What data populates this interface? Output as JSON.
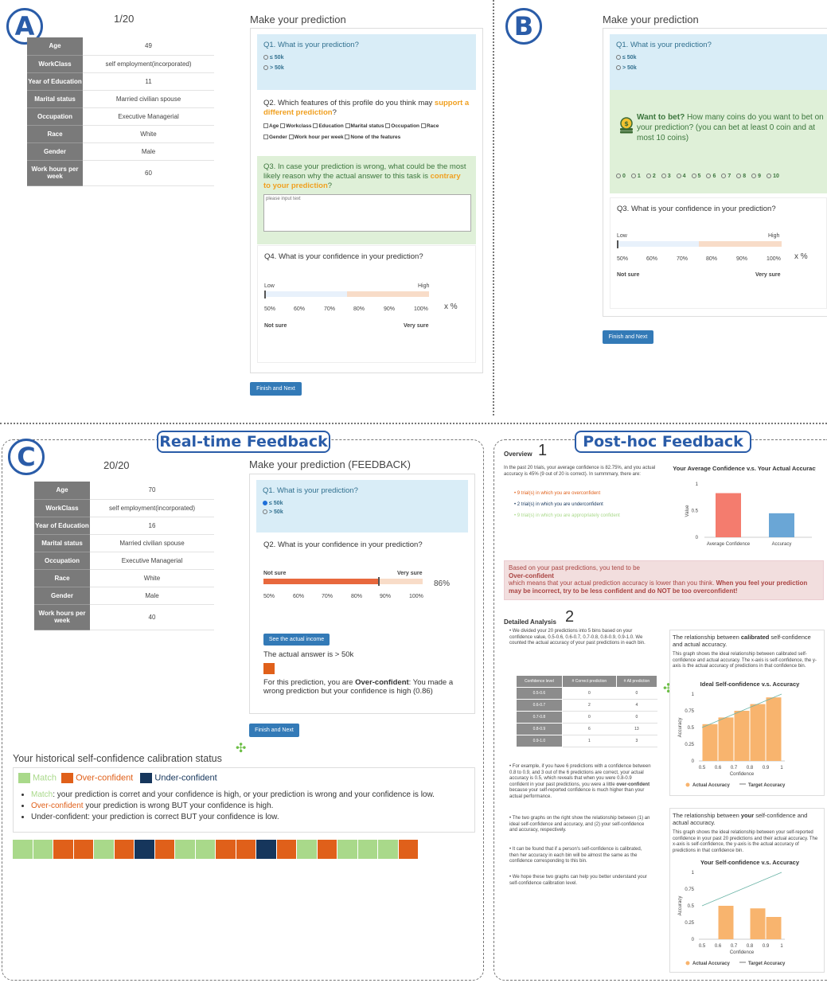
{
  "panels": {
    "a": "A",
    "b": "B",
    "c": "C"
  },
  "feedback_titles": {
    "realtime": "Real-time Feedback",
    "posthoc": "Post-hoc Feedback"
  },
  "panel_a": {
    "counter": "1/20",
    "heading": "Make your prediction",
    "profile": [
      [
        "Age",
        "49"
      ],
      [
        "WorkClass",
        "self employment(incorporated)"
      ],
      [
        "Year of Education",
        "11"
      ],
      [
        "Marital status",
        "Married civilian spouse"
      ],
      [
        "Occupation",
        "Executive Managerial"
      ],
      [
        "Race",
        "White"
      ],
      [
        "Gender",
        "Male"
      ],
      [
        "Work hours per week",
        "60"
      ]
    ],
    "q1": "Q1. What is your prediction?",
    "opt1": "≤ 50k",
    "opt2": "> 50k",
    "q2_pre": "Q2. Which features of this profile do you think may ",
    "q2_hl": "support a different prediction",
    "q2_post": "?",
    "features": [
      "Age",
      "Workclass",
      "Education",
      "Marital status",
      "Occupation",
      "Race",
      "Gender",
      "Work hour per week",
      "None of the features"
    ],
    "q3_pre": "Q3. In case your prediction is wrong, what could be the most likely reason why the actual answer to this task is ",
    "q3_hl": "contrary to your prediction",
    "q3_post": "?",
    "placeholder": "please input text",
    "q4": "Q4. What is your confidence in your prediction?",
    "low": "Low",
    "high": "High",
    "ticks": [
      "50%",
      "60%",
      "70%",
      "80%",
      "90%",
      "100%"
    ],
    "xpct": "x %",
    "not_sure": "Not sure",
    "very_sure": "Very sure",
    "button": "Finish and Next"
  },
  "panel_b": {
    "heading": "Make your prediction",
    "q1": "Q1. What is your prediction?",
    "opt1": "≤ 50k",
    "opt2": "> 50k",
    "bet_bold": "Want to bet?",
    "bet_text": " How many coins do you want to bet on your prediction? (you can bet at least 0 coin and at most 10 coins)",
    "coins": [
      "0",
      "1",
      "2",
      "3",
      "4",
      "5",
      "6",
      "7",
      "8",
      "9",
      "10"
    ],
    "q3": "Q3. What is your confidence in your prediction?",
    "low": "Low",
    "high": "High",
    "ticks": [
      "50%",
      "60%",
      "70%",
      "80%",
      "90%",
      "100%"
    ],
    "xpct": "x %",
    "not_sure": "Not sure",
    "very_sure": "Very sure",
    "button": "Finish and Next"
  },
  "panel_c": {
    "counter": "20/20",
    "heading": "Make your prediction (FEEDBACK)",
    "profile": [
      [
        "Age",
        "70"
      ],
      [
        "WorkClass",
        "self employment(incorporated)"
      ],
      [
        "Year of Education",
        "16"
      ],
      [
        "Marital status",
        "Married civilian spouse"
      ],
      [
        "Occupation",
        "Executive Managerial"
      ],
      [
        "Race",
        "White"
      ],
      [
        "Gender",
        "Male"
      ],
      [
        "Work hours per week",
        "40"
      ]
    ],
    "q1": "Q1. What is your prediction?",
    "opt1": "≤ 50k",
    "opt2": "> 50k",
    "q2": "Q2. What is your confidence in your prediction?",
    "not_sure": "Not sure",
    "very_sure": "Very sure",
    "confidence": "86%",
    "confidence_value": 0.86,
    "ticks": [
      "50%",
      "60%",
      "70%",
      "80%",
      "90%",
      "100%"
    ],
    "see_button": "See the actual income",
    "actual": "The actual answer is > 50k",
    "result_pre": "For this prediction, you are ",
    "result_bold": "Over-confident",
    "result_post": ": You made a wrong prediction but your confidence is high (0.86)",
    "button": "Finish and Next",
    "history_title": "Your historical self-confidence calibration status",
    "legend": {
      "match": "Match",
      "over": "Over-confident",
      "under": "Under-confident"
    },
    "explain": [
      {
        "tag": "Match",
        "text": ": your prediction is corret and your confidence is high, or your prediction is wrong and your confidence is low."
      },
      {
        "tag": "Over-confident",
        "text": " your prediction is wrong BUT your confidence is high."
      },
      {
        "tag": "Under-confident",
        "text": ": your prediction is correct BUT your confidence is low."
      }
    ],
    "history": [
      "M",
      "M",
      "O",
      "O",
      "M",
      "O",
      "U",
      "O",
      "M",
      "M",
      "O",
      "O",
      "U",
      "O",
      "M",
      "O",
      "M",
      "M",
      "M",
      "O"
    ]
  },
  "colors": {
    "match": "#a9d98a",
    "over": "#e0601a",
    "under": "#16365c",
    "accent": "#337ab7"
  },
  "posthoc": {
    "overview_title": "Overview",
    "num1": "1",
    "num2": "2",
    "overview_text": "In the past 20 trials, your average confidence is 82.75%, and you actual accuracy is 45% (9 out of 20 is correct). In summmary, there are:",
    "bullets": [
      "9 trial(s) in which you are overconfident",
      "2 trial(s) in which you are underconfident",
      "9 trial(s) in which you are appropriately confident"
    ],
    "alert_line1": "Based on your past predictions, you tend to be",
    "alert_bold": "Over-confident",
    "alert_line2": "which means that your actual prediction accuracy is lower than you think. ",
    "alert_bold2": "When you feel your prediction may be incorrect, try to be less confident and do NOT be too overconfident!",
    "detail_title": "Detailed Analysis",
    "detail_p1": "We divided your 20 predictions into 5 bins based on your confidence value, 0.5-0.6, 0.6-0.7, 0.7-0.8, 0.8-0.9, 0.9-1.0. We counted the actual accuracy of your past predictions in each bin.",
    "table_head": [
      "Confidence level",
      "# Correct prediction",
      "# All prediction"
    ],
    "table_rows": [
      [
        "0.5-0.6",
        "0",
        "0"
      ],
      [
        "0.6-0.7",
        "2",
        "4"
      ],
      [
        "0.7-0.8",
        "0",
        "0"
      ],
      [
        "0.8-0.9",
        "6",
        "13"
      ],
      [
        "0.9-1.0",
        "1",
        "3"
      ]
    ],
    "detail_p2_pre": "For example, if you have 6 predictions with a confidence between 0.8 to 0.9, and 3 out of the 6 predictions are correct, your actual accuracy is 0.5, which reveals that when you were 0.8-0.9 confident in your past predictions, you were a little ",
    "detail_p2_bold": "over-confident",
    "detail_p2_post": " because your self-reported confidence is much higher than your actual performance.",
    "detail_p3": "The two graphs on the right show the relationship between (1) an ideal self-confidence and accuracy, and (2) your self-confidence and accuracy, respectively.",
    "detail_p4": "It can be found that if a person's self-confidence is calibrated, then her accuracy in each bin will be almost the same as the confidence corresponding to this bin.",
    "detail_p5": "We hope these two graphs can help you better understand your self-confidence calibration level.",
    "card1_title_pre": "The relationship between ",
    "card1_title_bold": "calibrated",
    "card1_title_post": " self-confidence and actual accuracy.",
    "card1_desc": "This graph shows the ideal relationship between calibrated self-confidence and actual accuracy. The x-axis is self-confidence, the y-axis is the actual accuracy of predictions in that confidence bin.",
    "card2_title_pre": "The relationship between ",
    "card2_title_bold": "your",
    "card2_title_post": " self-confidence and actual accuracy.",
    "card2_desc": "This graph shows the ideal relationship between your self-reported confidence in your past 20 predictions and their actual accuracy. The x-axis is self-confidence, the y-axis is the actual accuracy of predictions in that confidence bin."
  },
  "chart_data": [
    {
      "type": "bar",
      "title": "Your Average Confidence v.s. Your Actual Accuracy",
      "categories": [
        "Average Confidence",
        "Accuracy"
      ],
      "values": [
        0.8275,
        0.45
      ],
      "ylabel": "Value",
      "ylim": [
        0,
        1
      ],
      "yticks": [
        "0",
        "0.5",
        "1"
      ],
      "colors": [
        "#f47c6e",
        "#6aa6d6"
      ]
    },
    {
      "type": "bar",
      "title": "Ideal Self-confidence v.s. Accuracy",
      "x": [
        0.55,
        0.65,
        0.75,
        0.85,
        0.95
      ],
      "values": [
        0.55,
        0.65,
        0.75,
        0.85,
        0.95
      ],
      "target": [
        [
          0.5,
          0.5
        ],
        [
          1,
          1
        ]
      ],
      "xlabel": "Confidence",
      "ylabel": "Accuracy",
      "ylim": [
        0,
        1
      ],
      "yticks": [
        "0",
        "0.25",
        "0.5",
        "0.75",
        "1"
      ],
      "xticks": [
        "0.5",
        "0.6",
        "0.7",
        "0.8",
        "0.9",
        "1"
      ],
      "legend": [
        "Actual Accuracy",
        "Target Accuracy"
      ]
    },
    {
      "type": "bar",
      "title": "Your Self-confidence v.s. Accuracy",
      "x": [
        0.55,
        0.65,
        0.75,
        0.85,
        0.95
      ],
      "values": [
        0,
        0.5,
        0,
        0.4615,
        0.3333
      ],
      "target": [
        [
          0.5,
          0.5
        ],
        [
          1,
          1
        ]
      ],
      "xlabel": "Confidence",
      "ylabel": "Accuracy",
      "ylim": [
        0,
        1
      ],
      "yticks": [
        "0",
        "0.25",
        "0.5",
        "0.75",
        "1"
      ],
      "xticks": [
        "0.5",
        "0.6",
        "0.7",
        "0.8",
        "0.9",
        "1"
      ],
      "legend": [
        "Actual Accuracy",
        "Target Accuracy"
      ]
    }
  ]
}
